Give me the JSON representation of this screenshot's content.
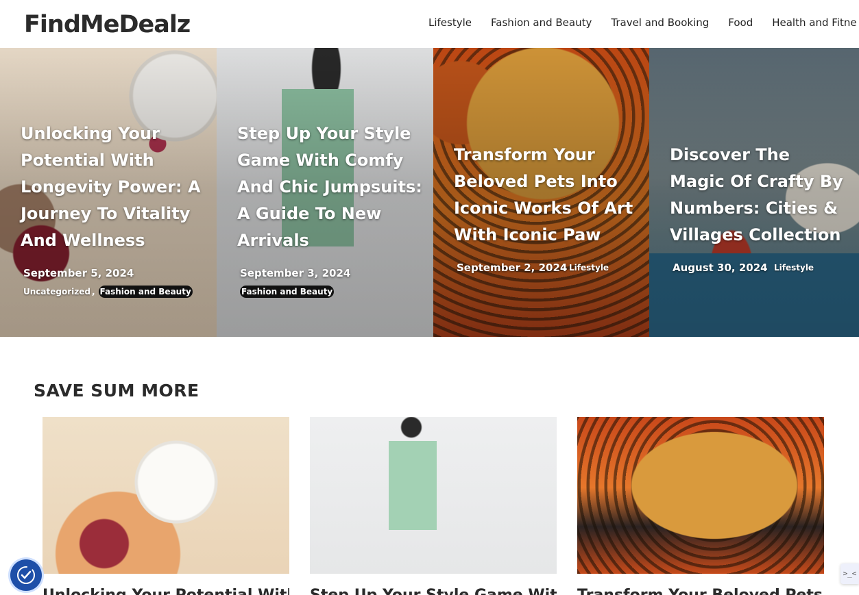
{
  "header": {
    "logo": "FindMeDealz",
    "nav": [
      {
        "label": "Lifestyle"
      },
      {
        "label": "Fashion and Beauty"
      },
      {
        "label": "Travel and Booking"
      },
      {
        "label": "Food"
      },
      {
        "label": "Health and Fitne"
      }
    ]
  },
  "hero": [
    {
      "title": "Unlocking Your Potential With Longevity Power: A Journey To Vitality And Wellness",
      "date": "September 5, 2024",
      "categories": [
        "Uncategorized",
        "Fashion and Beauty"
      ]
    },
    {
      "title": "Step Up Your Style Game With Comfy And Chic Jumpsuits: A Guide To New Arrivals",
      "date": "September 3, 2024",
      "categories": [
        "Fashion and Beauty"
      ]
    },
    {
      "title": "Transform Your Beloved Pets Into Iconic Works Of Art With Iconic Paw",
      "date": "September 2, 2024",
      "categories": [
        "Lifestyle"
      ]
    },
    {
      "title": "Discover The Magic Of Crafty By Numbers: Cities & Villages Collection",
      "date": "August 30, 2024",
      "categories": [
        "Lifestyle"
      ]
    }
  ],
  "section": {
    "title": "SAVE SUM MORE",
    "cards": [
      {
        "title": "Unlocking Your Potential With Longevity Power"
      },
      {
        "title": "Step Up Your Style Game With Comfy"
      },
      {
        "title": "Transform Your Beloved Pets Into"
      }
    ]
  },
  "widgets": {
    "accessibility_icon": "accessibility-check-icon",
    "side_label": ">_<"
  }
}
